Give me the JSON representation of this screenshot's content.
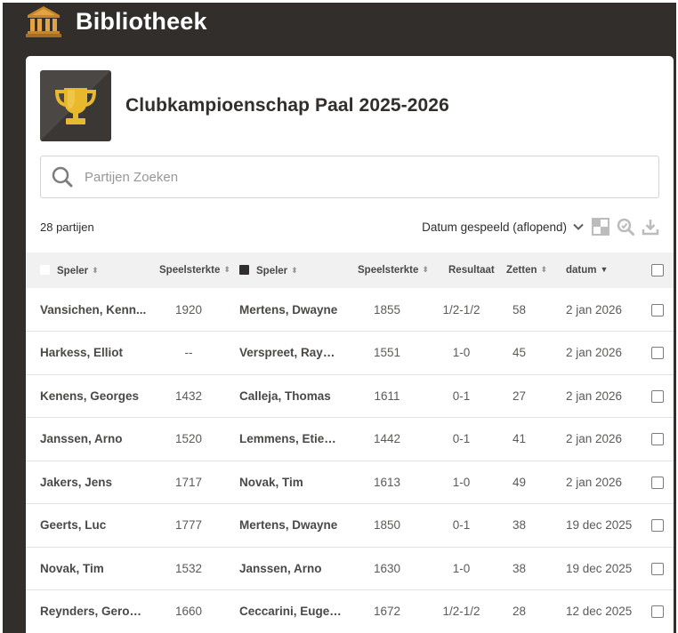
{
  "header": {
    "title": "Bibliotheek",
    "icon": "library-icon"
  },
  "club": {
    "title": "Clubkampioenschap Paal 2025-2026",
    "icon": "trophy-icon"
  },
  "search": {
    "placeholder": "Partijen Zoeken"
  },
  "toolbar": {
    "count": "28 partijen",
    "sort_label": "Datum gespeeld (aflopend)"
  },
  "table": {
    "headers": {
      "white_player": "Speler",
      "white_rating": "Speelsterkte",
      "black_player": "Speler",
      "black_rating": "Speelsterkte",
      "result": "Resultaat",
      "moves": "Zetten",
      "date": "datum"
    },
    "rows": [
      {
        "white": "Vansichen, Kenn...",
        "white_rating": "1920",
        "black": "Mertens, Dwayne",
        "black_rating": "1855",
        "result": "1/2-1/2",
        "moves": "58",
        "date": "2 jan 2026"
      },
      {
        "white": "Harkess, Elliot",
        "white_rating": "--",
        "black": "Verspreet, Raym...",
        "black_rating": "1551",
        "result": "1-0",
        "moves": "45",
        "date": "2 jan 2026"
      },
      {
        "white": "Kenens, Georges",
        "white_rating": "1432",
        "black": "Calleja, Thomas",
        "black_rating": "1611",
        "result": "0-1",
        "moves": "27",
        "date": "2 jan 2026"
      },
      {
        "white": "Janssen, Arno",
        "white_rating": "1520",
        "black": "Lemmens, Etienne",
        "black_rating": "1442",
        "result": "0-1",
        "moves": "41",
        "date": "2 jan 2026"
      },
      {
        "white": "Jakers, Jens",
        "white_rating": "1717",
        "black": "Novak, Tim",
        "black_rating": "1613",
        "result": "1-0",
        "moves": "49",
        "date": "2 jan 2026"
      },
      {
        "white": "Geerts, Luc",
        "white_rating": "1777",
        "black": "Mertens, Dwayne",
        "black_rating": "1850",
        "result": "0-1",
        "moves": "38",
        "date": "19 dec 2025"
      },
      {
        "white": "Novak, Tim",
        "white_rating": "1532",
        "black": "Janssen, Arno",
        "black_rating": "1630",
        "result": "1-0",
        "moves": "38",
        "date": "19 dec 2025"
      },
      {
        "white": "Reynders, Gerome",
        "white_rating": "1660",
        "black": "Ceccarini, Eugenio",
        "black_rating": "1672",
        "result": "1/2-1/2",
        "moves": "28",
        "date": "12 dec 2025"
      }
    ]
  },
  "colors": {
    "background": "#312e2b",
    "card": "#ffffff",
    "header_row": "#f1f1f1",
    "trophy": "#e8b82d"
  }
}
